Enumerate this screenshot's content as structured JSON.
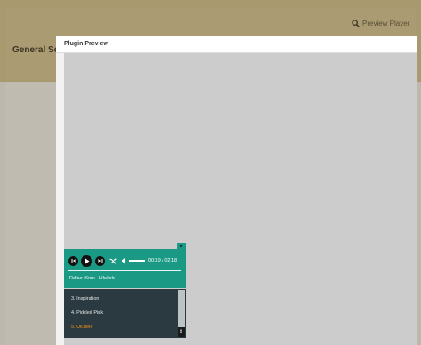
{
  "background": {
    "page_title": "General Se",
    "preview_link": "Preview Player"
  },
  "modal": {
    "title": "Plugin Preview"
  },
  "player": {
    "time": "00:19 / 02:18",
    "now_playing": "Rafael Krux - Ukulele",
    "progress": 0.14,
    "accent_color": "#1a9a85",
    "playlist": [
      {
        "label": "3. Inspiration",
        "active": false
      },
      {
        "label": "4. Pickled Pink",
        "active": false
      },
      {
        "label": "5. Ukulele",
        "active": true
      }
    ]
  }
}
